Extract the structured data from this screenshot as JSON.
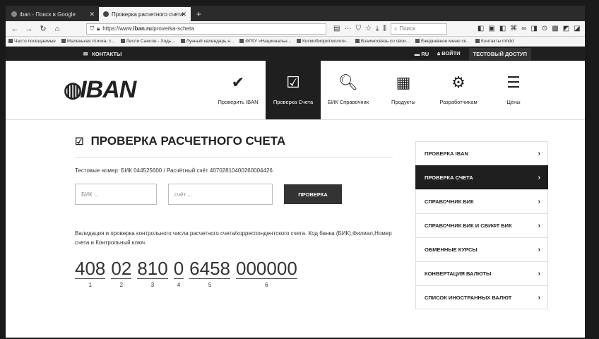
{
  "browser": {
    "tabs": [
      {
        "title": "iban - Поиск в Google",
        "active": false
      },
      {
        "title": "Проверка расчетного счета",
        "active": true
      }
    ],
    "new_tab": "+",
    "url_prefix": "https://www.",
    "url_host": "iban.ru",
    "url_path": "/proverka-scheta",
    "search_placeholder": "Поиск",
    "bookmarks": [
      "Часто посещаемые",
      "Маленькая птичка, с...",
      "Лесли Сансон - Ходь...",
      "Лунный календарь н...",
      "ФГБУ «Национальн...",
      "Космобиоритмологи...",
      "Взаимосвязь со свои...",
      "Ежедневное меню ск...",
      "Контакты mhdd"
    ]
  },
  "site": {
    "topbar": {
      "contacts": "КОНТАКТЫ",
      "lang": "RU",
      "login": "ВОЙТИ",
      "test_access": "ТЕСТОВЫЙ ДОСТУП"
    },
    "logo": "IBAN",
    "menu": [
      {
        "label": "Проверить IBAN",
        "icon": "checkmark-icon",
        "glyph": "✔",
        "active": false
      },
      {
        "label": "Проверка Счета",
        "icon": "checkbox-icon",
        "glyph": "☑",
        "active": true
      },
      {
        "label": "БИК Справочник",
        "icon": "search-icon",
        "glyph": "🔍︎",
        "active": false
      },
      {
        "label": "Продукты",
        "icon": "grid-icon",
        "glyph": "▦",
        "active": false
      },
      {
        "label": "Разработчикам",
        "icon": "gears-icon",
        "glyph": "⚙",
        "active": false
      },
      {
        "label": "Цены",
        "icon": "server-icon",
        "glyph": "☰",
        "active": false
      }
    ]
  },
  "main": {
    "title": "ПРОВЕРКА РАСЧЕТНОГО СЧЕТА",
    "test_line": "Тестовые номер: БИК 044525600 / Расчётный счёт 40702810400260004426",
    "bik_placeholder": "БИК ...",
    "account_placeholder": "счёт ...",
    "check_button": "ПРОВЕРКА",
    "description": "Валидация и проверка контрольного числа расчетного счета/корреспондентского счета. Код банка (БИК),Филиал,Номер счета и Контрольный ключ.",
    "digit_groups": [
      {
        "num": "408",
        "label": "1"
      },
      {
        "num": "02",
        "label": "2"
      },
      {
        "num": "810",
        "label": "3"
      },
      {
        "num": "0",
        "label": "4"
      },
      {
        "num": "6458",
        "label": "5"
      },
      {
        "num": "000000",
        "label": "6"
      }
    ]
  },
  "sidebar": {
    "items": [
      {
        "label": "ПРОВЕРКА IBAN",
        "active": false
      },
      {
        "label": "ПРОВЕРКА СЧЕТА",
        "active": true
      },
      {
        "label": "СПРАВОЧНИК БИК",
        "active": false
      },
      {
        "label": "СПРАВОЧНИК БИК И СВИФТ БИК",
        "active": false
      },
      {
        "label": "ОБМЕННЫЕ КУРСЫ",
        "active": false
      },
      {
        "label": "КОНВЕРТАЦИЯ ВАЛЮТЫ",
        "active": false
      },
      {
        "label": "СПИСОК ИНОСТРАННЫХ ВАЛЮТ",
        "active": false
      }
    ],
    "arrow": "›"
  }
}
